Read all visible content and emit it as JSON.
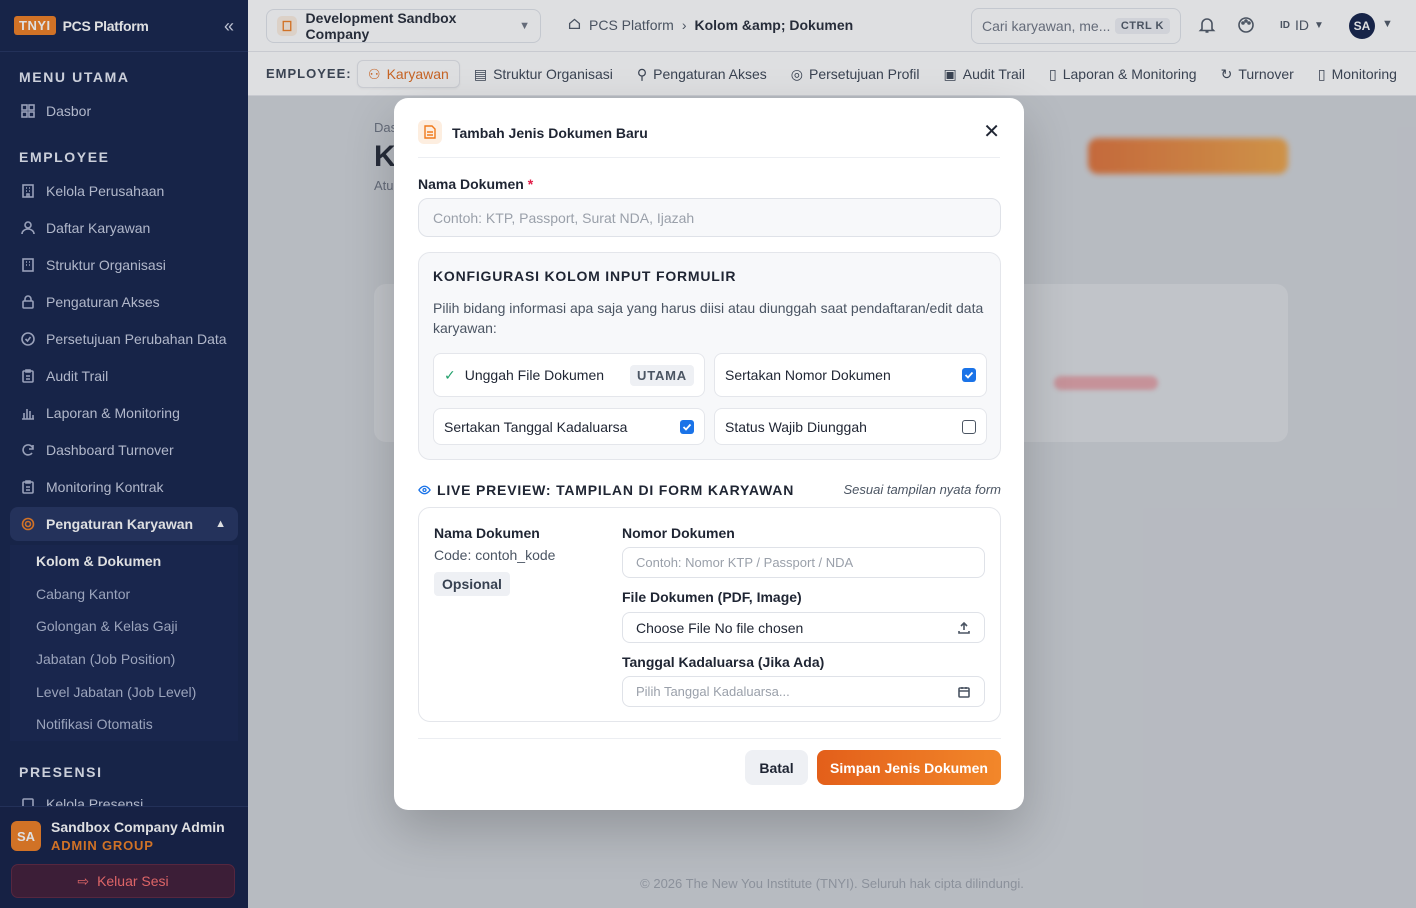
{
  "sidebar": {
    "logo_badge": "TNYI",
    "logo_text": "PCS Platform",
    "section_main": "MENU UTAMA",
    "section_employee": "EMPLOYEE",
    "section_presensi": "PRESENSI",
    "dashboard": "Dasbor",
    "items": [
      "Kelola Perusahaan",
      "Daftar Karyawan",
      "Struktur Organisasi",
      "Pengaturan Akses",
      "Persetujuan Perubahan Data",
      "Audit Trail",
      "Laporan & Monitoring",
      "Dashboard Turnover",
      "Monitoring Kontrak"
    ],
    "active_item": "Pengaturan Karyawan",
    "subitems": [
      "Kolom & Dokumen",
      "Cabang Kantor",
      "Golongan & Kelas Gaji",
      "Jabatan (Job Position)",
      "Level Jabatan (Job Level)",
      "Notifikasi Otomatis"
    ],
    "presensi_item": "Kelola Presensi",
    "user_initials": "SA",
    "user_name": "Sandbox Company Admin",
    "user_group": "ADMIN GROUP",
    "logout": "Keluar Sesi"
  },
  "topbar": {
    "company": "Development Sandbox Company",
    "crumb_home": "PCS Platform",
    "crumb_current": "Kolom &amp; Dokumen",
    "search_placeholder": "Cari karyawan, me...",
    "search_kbd": "CTRL K",
    "lang_icon": "ID",
    "lang": "ID",
    "avatar": "SA"
  },
  "tabbar": {
    "prefix": "EMPLOYEE:",
    "tabs": [
      "Karyawan",
      "Struktur Organisasi",
      "Pengaturan Akses",
      "Persetujuan Profil",
      "Audit Trail",
      "Laporan & Monitoring",
      "Turnover",
      "Monitoring"
    ]
  },
  "background": {
    "crumb": "Das",
    "title": "K",
    "subtitle": "Atu",
    "footer": "© 2026 The New You Institute (TNYI). Seluruh hak cipta dilindungi."
  },
  "modal": {
    "title": "Tambah Jenis Dokumen Baru",
    "name_label": "Nama Dokumen",
    "required_mark": "*",
    "name_placeholder": "Contoh: KTP, Passport, Surat NDA, Ijazah",
    "config_title": "KONFIGURASI KOLOM INPUT FORMULIR",
    "config_desc": "Pilih bidang informasi apa saja yang harus diisi atau diunggah saat pendaftaran/edit data karyawan:",
    "opt_upload": "Unggah File Dokumen",
    "opt_upload_tag": "UTAMA",
    "opt_number": "Sertakan Nomor Dokumen",
    "opt_number_checked": true,
    "opt_expiry": "Sertakan Tanggal Kadaluarsa",
    "opt_expiry_checked": true,
    "opt_mandatory": "Status Wajib Diunggah",
    "opt_mandatory_checked": false,
    "preview_title": "LIVE PREVIEW: TAMPILAN DI FORM KARYAWAN",
    "preview_note": "Sesuai tampilan nyata form",
    "pv_name": "Nama Dokumen",
    "pv_code": "Code: contoh_kode",
    "pv_badge": "Opsional",
    "pv_number_label": "Nomor Dokumen",
    "pv_number_placeholder": "Contoh: Nomor KTP / Passport / NDA",
    "pv_file_label": "File Dokumen (PDF, Image)",
    "pv_file_value": "Choose File No file chosen",
    "pv_expiry_label": "Tanggal Kadaluarsa (Jika Ada)",
    "pv_expiry_placeholder": "Pilih Tanggal Kadaluarsa...",
    "cancel": "Batal",
    "save": "Simpan Jenis Dokumen"
  },
  "colors": {
    "accent": "#f07a1c",
    "sidebar": "#0d1b45",
    "checkbox": "#1a73e8"
  }
}
